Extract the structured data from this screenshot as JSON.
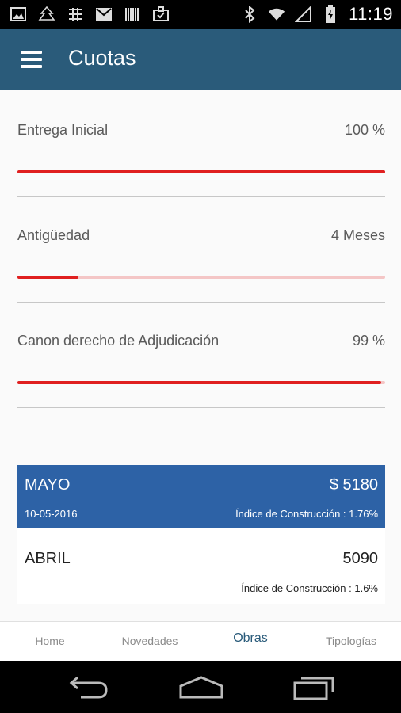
{
  "status_bar": {
    "time": "11:19"
  },
  "app_bar": {
    "title": "Cuotas"
  },
  "settings": [
    {
      "label": "Entrega Inicial",
      "value": "100 %",
      "level": 1.0
    },
    {
      "label": "Antigüedad",
      "value": "4 Meses",
      "level": 0.165
    },
    {
      "label": "Canon derecho de Adjudicación",
      "value": "99 %",
      "level": 0.99
    }
  ],
  "installments": {
    "current": {
      "month": "MAYO",
      "amount": "$ 5180",
      "date": "10-05-2016",
      "index": "Índice de Construcción : 1.76%"
    },
    "previous": {
      "month": "ABRIL",
      "amount": "5090",
      "index": "Índice de Construcción : 1.6%"
    }
  },
  "bottom_tabs": [
    "Home",
    "Novedades",
    "Obras",
    "Tipologías"
  ],
  "colors": {
    "app_bar": "#2a5b7a",
    "accent_red": "#e02020",
    "card_blue": "#2d62a6"
  }
}
